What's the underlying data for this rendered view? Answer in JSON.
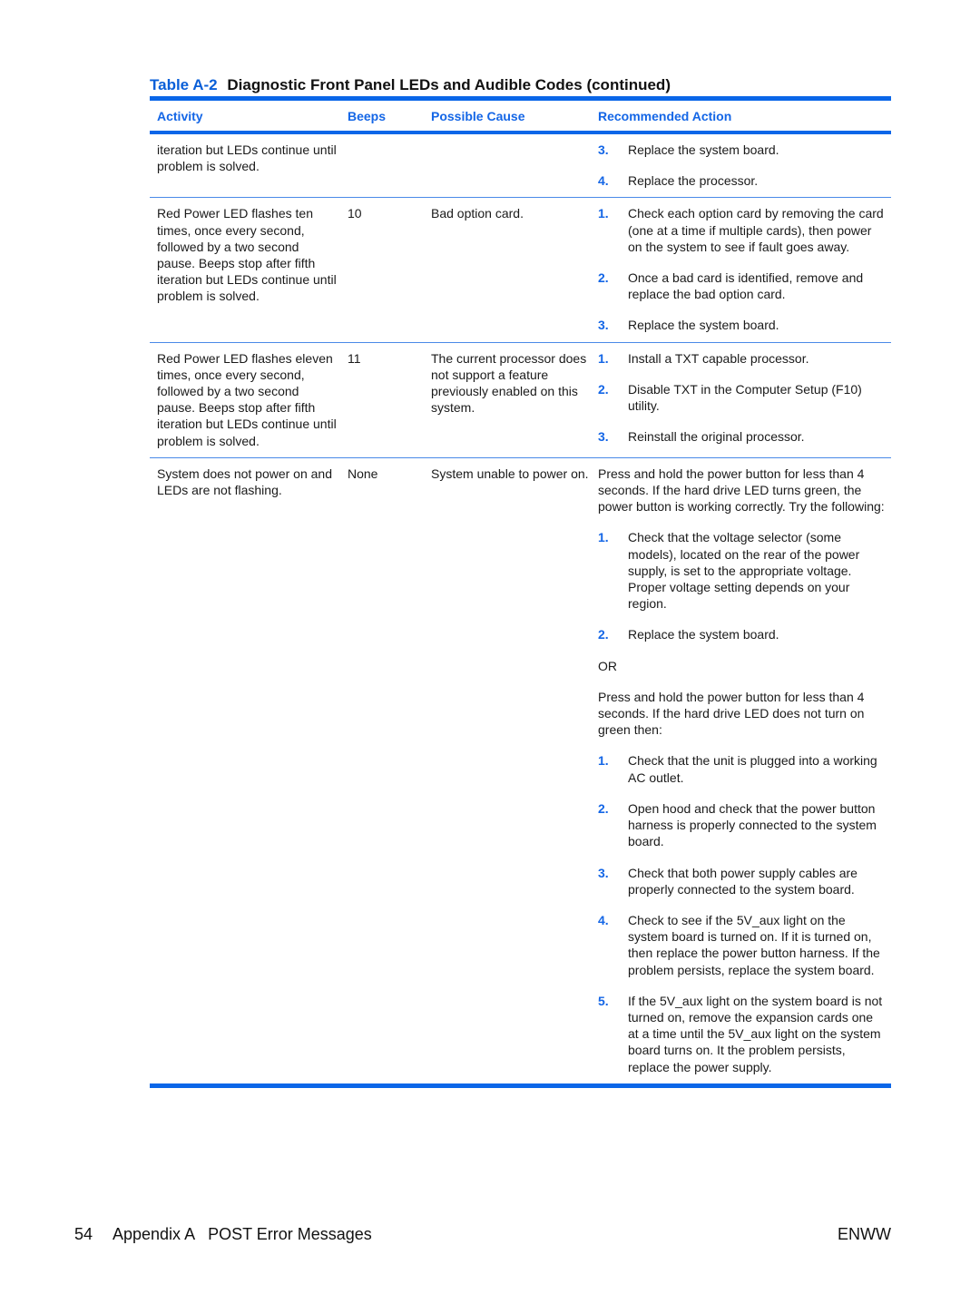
{
  "caption": {
    "number": "Table A-2",
    "title": "Diagnostic Front Panel LEDs and Audible Codes (continued)"
  },
  "columns": {
    "activity": "Activity",
    "beeps": "Beeps",
    "cause": "Possible Cause",
    "action": "Recommended Action"
  },
  "rows": [
    {
      "activity": "iteration but LEDs continue until problem is solved.",
      "beeps": "",
      "cause": "",
      "steps": [
        {
          "n": "3.",
          "t": "Replace the system board."
        },
        {
          "n": "4.",
          "t": "Replace the processor."
        }
      ]
    },
    {
      "activity": "Red Power LED flashes ten times, once every second, followed by a two second pause. Beeps stop after fifth iteration but LEDs continue until problem is solved.",
      "beeps": "10",
      "cause": "Bad option card.",
      "steps": [
        {
          "n": "1.",
          "t": "Check each option card by removing the card (one at a time if multiple cards), then power on the system to see if fault goes away."
        },
        {
          "n": "2.",
          "t": "Once a bad card is identified, remove and replace the bad option card."
        },
        {
          "n": "3.",
          "t": "Replace the system board."
        }
      ]
    },
    {
      "activity": "Red Power LED flashes eleven times, once every second, followed by a two second pause. Beeps stop after fifth iteration but LEDs continue until problem is solved.",
      "beeps": "11",
      "cause": "The current processor does not support a feature previously enabled on this system.",
      "steps": [
        {
          "n": "1.",
          "t": "Install a TXT capable processor."
        },
        {
          "n": "2.",
          "t": "Disable TXT in the Computer Setup (F10) utility."
        },
        {
          "n": "3.",
          "t": "Reinstall the original processor."
        }
      ]
    },
    {
      "activity": "System does not power on and LEDs are not flashing.",
      "beeps": "None",
      "cause": "System unable to power on.",
      "intro": "Press and hold the power button for less than 4 seconds. If the hard drive LED turns green, the power button is working correctly. Try the following:",
      "steps_a": [
        {
          "n": "1.",
          "t": "Check that the voltage selector (some models), located on the rear of the power supply, is set to the appropriate voltage. Proper voltage setting depends on your region."
        },
        {
          "n": "2.",
          "t": "Replace the system board."
        }
      ],
      "or": "OR",
      "intro_b": "Press and hold the power button for less than 4 seconds. If the hard drive LED does not turn on green then:",
      "steps_b": [
        {
          "n": "1.",
          "t": "Check that the unit is plugged into a working AC outlet."
        },
        {
          "n": "2.",
          "t": "Open hood and check that the power button harness is properly connected to the system board."
        },
        {
          "n": "3.",
          "t": "Check that both power supply cables are properly connected to the system board."
        },
        {
          "n": "4.",
          "t": "Check to see if the 5V_aux light on the system board is turned on. If it is turned on, then replace the power button harness. If the problem persists, replace the system board."
        },
        {
          "n": "5.",
          "t": "If the 5V_aux light on the system board is not turned on, remove the expansion cards one at a time until the 5V_aux light on the system board turns on. It the problem persists, replace the power supply."
        }
      ]
    }
  ],
  "footer": {
    "page_number": "54",
    "section": "Appendix A   POST Error Messages",
    "right": "ENWW"
  },
  "colors": {
    "accent": "#0a66e8"
  }
}
